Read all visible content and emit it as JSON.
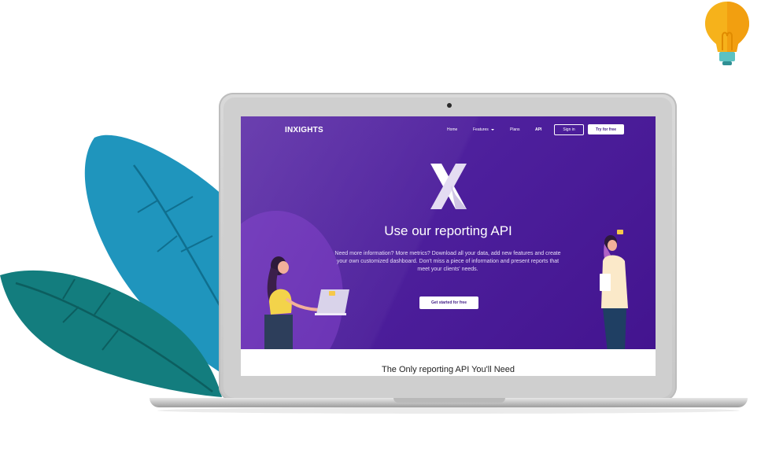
{
  "site": {
    "brand": "INXIGHTS",
    "nav": {
      "home": "Home",
      "features": "Features",
      "plans": "Plans",
      "api": "API",
      "sign_in": "Sign in",
      "try_free": "Try for free"
    },
    "hero": {
      "logo_letter": "X",
      "title": "Use our reporting API",
      "description": "Need more information? More metrics? Download all your data, add new features and create your own customized dashboard. Don't miss a piece of information and present reports that meet your clients' needs.",
      "cta": "Get started for free"
    },
    "section": {
      "title": "The Only reporting API You'll Need"
    }
  },
  "colors": {
    "hero_purple": "#4d1f9c",
    "leaf_blue": "#1f95bd",
    "leaf_teal": "#137d7e",
    "bulb_yellow": "#f6b21b",
    "laptop_silver": "#d0d0d0"
  },
  "icons": [
    "lightbulb-icon",
    "leaf-left-icon",
    "leaf-back-icon",
    "x-logo-icon",
    "caret-down-icon",
    "webcam-icon"
  ]
}
